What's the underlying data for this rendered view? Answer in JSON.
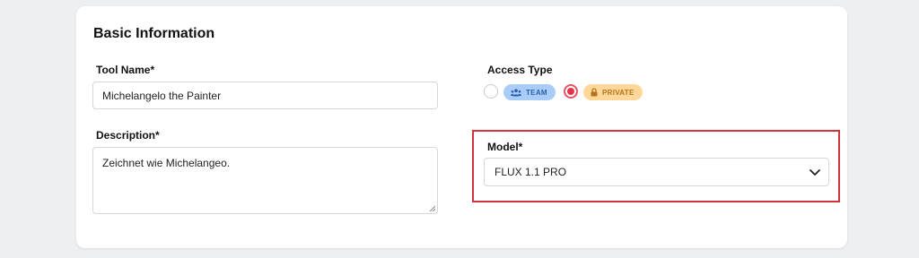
{
  "section": {
    "title": "Basic Information"
  },
  "tool_name": {
    "label": "Tool Name*",
    "value": "Michelangelo the Painter"
  },
  "description": {
    "label": "Description*",
    "value": "Zeichnet wie Michelangeo."
  },
  "access_type": {
    "label": "Access Type",
    "options": [
      {
        "label": "TEAM",
        "icon": "team-icon",
        "selected": false
      },
      {
        "label": "PRIVATE",
        "icon": "lock-icon",
        "selected": true
      }
    ]
  },
  "model": {
    "label": "Model*",
    "selected": "FLUX 1.1 PRO"
  },
  "colors": {
    "highlight": "#d0353b",
    "team_pill": "#a9cdf7",
    "private_pill": "#ffd79a",
    "radio_selected": "#e8344a"
  }
}
